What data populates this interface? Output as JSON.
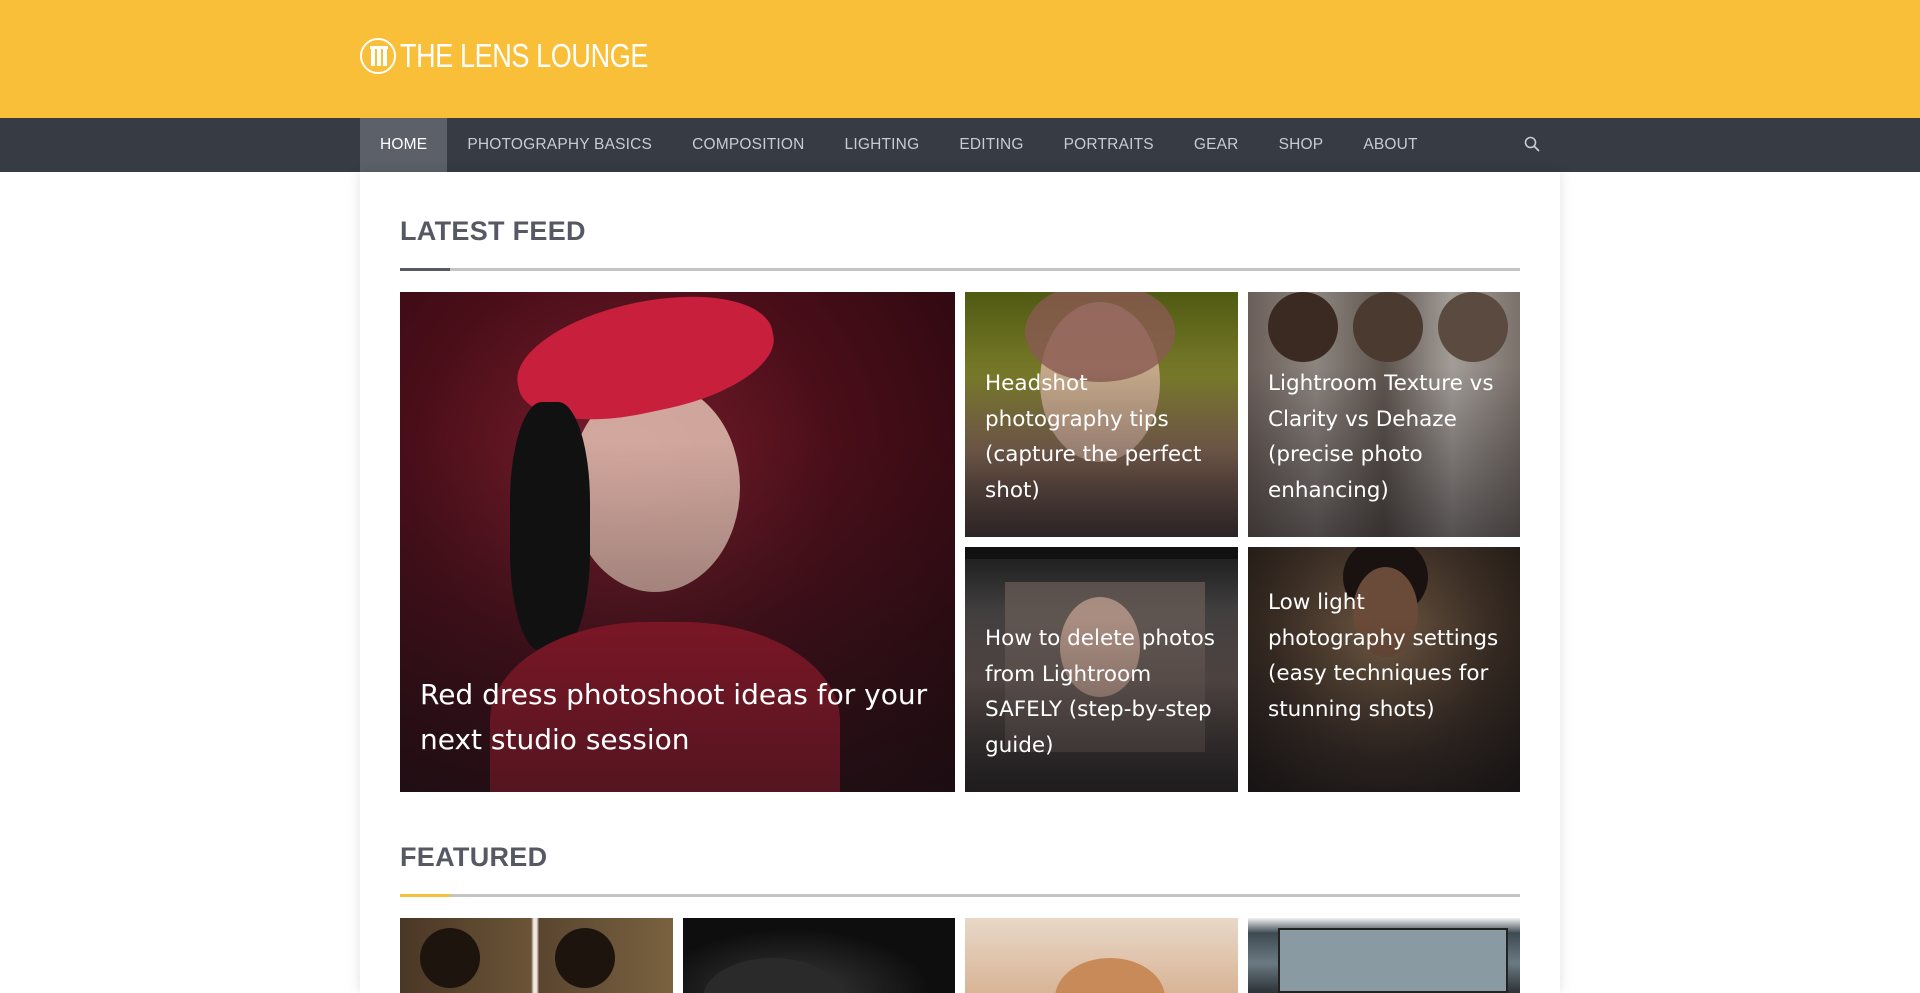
{
  "site": {
    "logo_text": "THE LENS LOUNGE",
    "brand_color": "#f9bf38"
  },
  "nav": {
    "items": [
      {
        "label": "HOME",
        "active": true
      },
      {
        "label": "PHOTOGRAPHY BASICS"
      },
      {
        "label": "COMPOSITION"
      },
      {
        "label": "LIGHTING"
      },
      {
        "label": "EDITING"
      },
      {
        "label": "PORTRAITS"
      },
      {
        "label": "GEAR"
      },
      {
        "label": "SHOP"
      },
      {
        "label": "ABOUT"
      }
    ],
    "search_icon": "search-icon"
  },
  "latest": {
    "title": "LATEST FEED",
    "accent_color": "#565963",
    "posts": [
      {
        "title": "Red dress photoshoot ideas for your next studio session"
      },
      {
        "title": "Headshot photography tips (capture the perfect shot)"
      },
      {
        "title": "Lightroom Texture vs Clarity vs Dehaze (precise photo enhancing)"
      },
      {
        "title": "How to delete photos from Lightroom SAFELY (step-by-step guide)"
      },
      {
        "title": "Low light photography settings (easy techniques for stunning shots)"
      }
    ]
  },
  "featured": {
    "title": "FEATURED",
    "accent_color": "#f9bf38"
  }
}
